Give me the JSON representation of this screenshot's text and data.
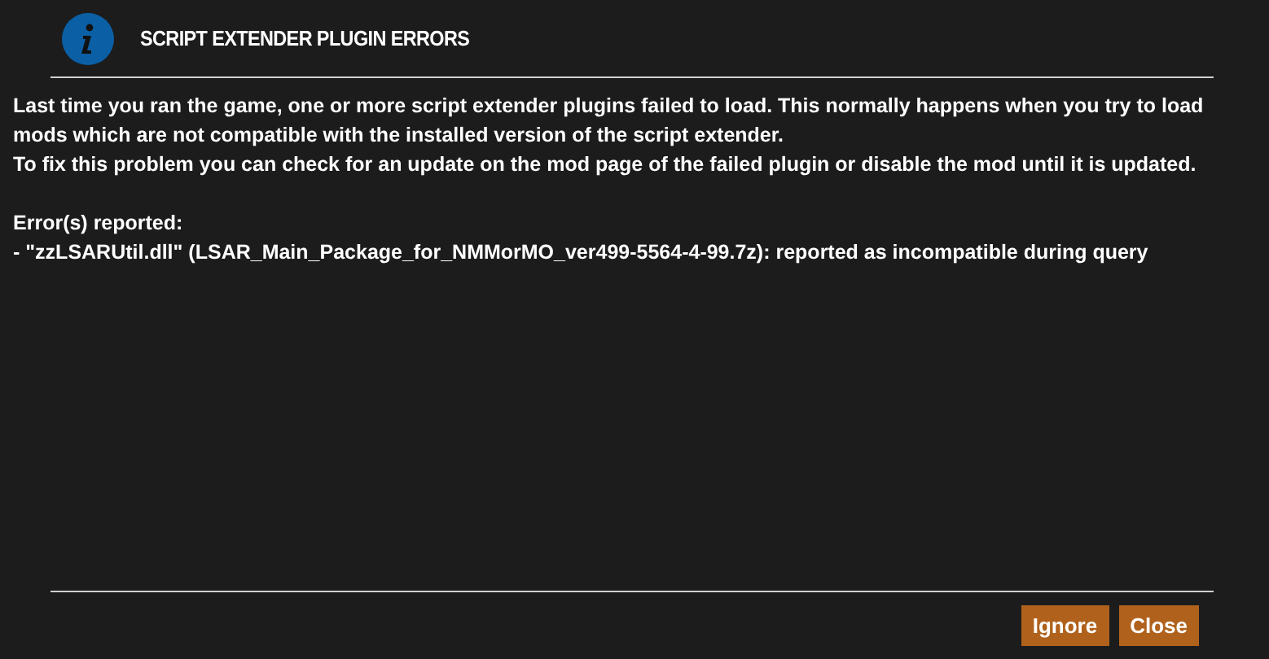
{
  "dialog": {
    "title": "SCRIPT EXTENDER PLUGIN ERRORS",
    "paragraphs": [
      [
        "Last time you ran the game, one or more script extender plugins failed to load. This normally happens when you try to load",
        "mods which are not compatible with the installed version of the script extender.",
        "To fix this problem you can check for an update on the mod page of the failed plugin or disable the mod until it is updated."
      ],
      [
        "Error(s) reported:",
        "- \"zzLSARUtil.dll\" (LSAR_Main_Package_for_NMMorMO_ver499-5564-4-99.7z): reported as incompatible during query"
      ]
    ],
    "buttons": [
      "Ignore",
      "Close"
    ]
  }
}
